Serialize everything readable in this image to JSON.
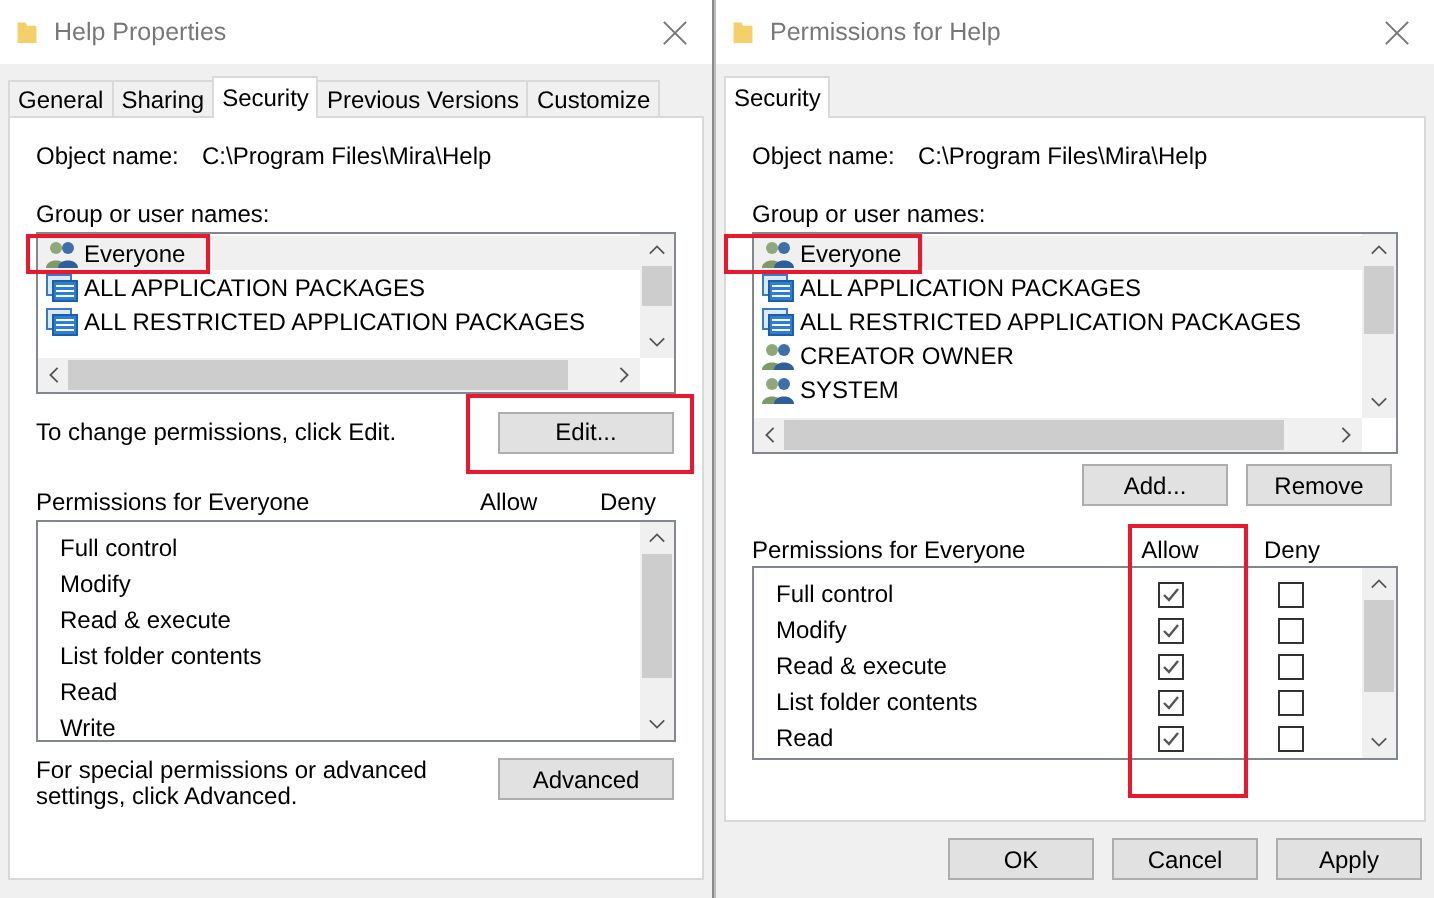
{
  "properties_window": {
    "title": "Help Properties",
    "tabs": [
      {
        "label": "General",
        "selected": false
      },
      {
        "label": "Sharing",
        "selected": false
      },
      {
        "label": "Security",
        "selected": true
      },
      {
        "label": "Previous Versions",
        "selected": false
      },
      {
        "label": "Customize",
        "selected": false
      }
    ],
    "object_name_label": "Object name:",
    "object_name": "C:\\Program Files\\Mira\\Help",
    "group_label": "Group or user names:",
    "users": [
      {
        "name": "Everyone",
        "kind": "group",
        "selected": true,
        "highlighted": true
      },
      {
        "name": "ALL APPLICATION PACKAGES",
        "kind": "package",
        "selected": false,
        "highlighted": false
      },
      {
        "name": "ALL RESTRICTED APPLICATION PACKAGES",
        "kind": "package",
        "selected": false,
        "highlighted": false
      }
    ],
    "change_hint": "To change permissions, click Edit.",
    "edit_button": {
      "label": "Edit...",
      "highlighted": true
    },
    "permissions_label": "Permissions for Everyone",
    "allow_label": "Allow",
    "deny_label": "Deny",
    "permissions": [
      "Full control",
      "Modify",
      "Read & execute",
      "List folder contents",
      "Read",
      "Write"
    ],
    "advanced_hint": "For special permissions or advanced settings, click Advanced.",
    "advanced_button": "Advanced"
  },
  "permissions_window": {
    "title": "Permissions for Help",
    "tabs": [
      {
        "label": "Security",
        "selected": true
      }
    ],
    "object_name_label": "Object name:",
    "object_name": "C:\\Program Files\\Mira\\Help",
    "group_label": "Group or user names:",
    "users": [
      {
        "name": "Everyone",
        "kind": "group",
        "selected": true,
        "highlighted": true
      },
      {
        "name": "ALL APPLICATION PACKAGES",
        "kind": "package",
        "selected": false,
        "highlighted": false
      },
      {
        "name": "ALL RESTRICTED APPLICATION PACKAGES",
        "kind": "package",
        "selected": false,
        "highlighted": false
      },
      {
        "name": "CREATOR OWNER",
        "kind": "group",
        "selected": false,
        "highlighted": false
      },
      {
        "name": "SYSTEM",
        "kind": "group",
        "selected": false,
        "highlighted": false
      }
    ],
    "add_button": "Add...",
    "remove_button": "Remove",
    "permissions_label": "Permissions for Everyone",
    "allow_label": "Allow",
    "deny_label": "Deny",
    "allow_highlighted": true,
    "permissions": [
      {
        "name": "Full control",
        "allow": true,
        "deny": false
      },
      {
        "name": "Modify",
        "allow": true,
        "deny": false
      },
      {
        "name": "Read & execute",
        "allow": true,
        "deny": false
      },
      {
        "name": "List folder contents",
        "allow": true,
        "deny": false
      },
      {
        "name": "Read",
        "allow": true,
        "deny": false
      }
    ],
    "buttons": [
      "OK",
      "Cancel",
      "Apply"
    ]
  }
}
